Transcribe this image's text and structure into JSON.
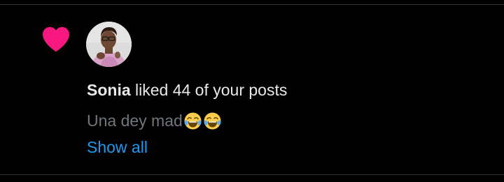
{
  "notification": {
    "type_icon": "heart-icon",
    "icon_color": "#f91880",
    "avatar_icon": "avatar-photo",
    "user_name": "Sonia",
    "action_text": " liked 44 of your posts",
    "post_preview_text": "Una dey mad",
    "post_preview_emojis": [
      "face-with-tears-of-joy-icon",
      "face-with-tears-of-joy-icon"
    ],
    "show_all_label": "Show all"
  },
  "colors": {
    "background": "#000000",
    "divider": "#2f3336",
    "primary_text": "#e7e9ea",
    "secondary_text": "#71767b",
    "link": "#1d9bf0"
  }
}
